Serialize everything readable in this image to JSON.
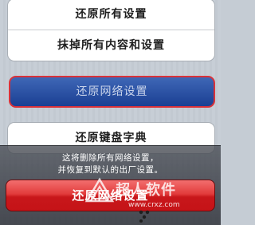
{
  "settings": {
    "reset_all_settings": "还原所有设置",
    "erase_all_content": "抹掉所有内容和设置",
    "reset_network_settings": "还原网络设置",
    "reset_keyboard_dictionary": "还原键盘字典"
  },
  "action_sheet": {
    "message_line1": "这将删除所有网络设置，",
    "message_line2": "并恢复到默认的出厂设置。",
    "confirm_label": "还原网络设置"
  },
  "watermark": {
    "brand": "超人软件",
    "url": "www.crxz.com"
  },
  "colors": {
    "highlight_blue": "#1a3f93",
    "highlight_border": "#d9323a",
    "destructive_red": "#c8171b"
  }
}
